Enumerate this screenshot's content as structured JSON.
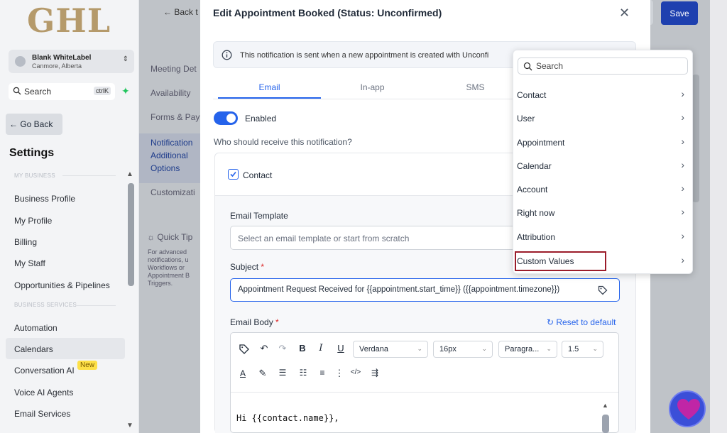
{
  "sidebar": {
    "logo": "GHL",
    "account": {
      "name": "Blank WhiteLabel",
      "location": "Canmore, Alberta"
    },
    "search": {
      "label": "Search",
      "shortcut": "ctrlK"
    },
    "go_back": "← Go Back",
    "title": "Settings",
    "sections": {
      "my_business": "MY BUSINESS",
      "business_services": "BUSINESS SERVICES"
    },
    "items": [
      {
        "label": "Business Profile"
      },
      {
        "label": "My Profile"
      },
      {
        "label": "Billing"
      },
      {
        "label": "My Staff"
      },
      {
        "label": "Opportunities & Pipelines"
      },
      {
        "label": "Automation"
      },
      {
        "label": "Calendars"
      },
      {
        "label": "Conversation AI"
      },
      {
        "label": "Voice AI Agents"
      },
      {
        "label": "Email Services"
      }
    ],
    "new_badge": "New"
  },
  "background_page": {
    "back_label": "← Back t",
    "save_label": "Save",
    "links": [
      "Meeting Det",
      "Availability",
      "Forms & Pay",
      "Customizati"
    ],
    "notifications_links": [
      "Notification",
      "Additional",
      "Options"
    ],
    "quick_tips_title": "Quick Tip",
    "quick_tips_text": "For advanced notifications, u Workflows or Appointment B Triggers."
  },
  "modal": {
    "title": "Edit Appointment Booked (Status: Unconfirmed)",
    "info_text": "This notification is sent when a new appointment is created with Unconfi",
    "tabs": {
      "email": "Email",
      "in_app": "In-app",
      "sms": "SMS"
    },
    "enabled_label": "Enabled",
    "who_label": "Who should receive this notification?",
    "contact_label": "Contact",
    "email_template_label": "Email Template",
    "email_template_placeholder": "Select an email template or start from scratch",
    "subject_label": "Subject",
    "required_mark": "*",
    "subject_value": "Appointment Request Received for {{appointment.start_time}} ({{appointment.timezone}})",
    "email_body_label": "Email Body",
    "reset_label": "Reset to default",
    "toolbar": {
      "font": "Verdana",
      "size": "16px",
      "block": "Paragra...",
      "line_height": "1.5"
    },
    "body_text": "Hi {{contact.name}},"
  },
  "dropdown": {
    "search_placeholder": "Search",
    "items": [
      {
        "label": "Contact"
      },
      {
        "label": "User"
      },
      {
        "label": "Appointment"
      },
      {
        "label": "Calendar"
      },
      {
        "label": "Account"
      },
      {
        "label": "Right now"
      },
      {
        "label": "Attribution"
      },
      {
        "label": "Custom Values"
      }
    ]
  },
  "colors": {
    "accent": "#2563eb",
    "save": "#1e40af",
    "highlight_box": "#9b1c2a",
    "new_badge": "#fde047"
  }
}
